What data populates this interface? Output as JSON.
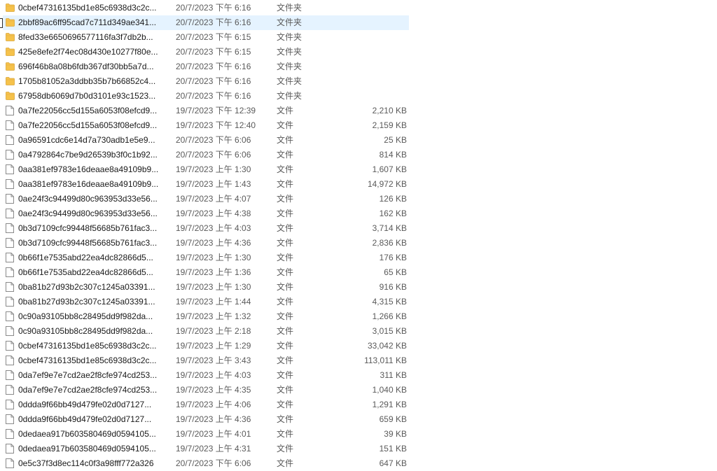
{
  "colors": {
    "folder": "#f6c24a",
    "hover_bg": "#e5f3ff"
  },
  "files": [
    {
      "name": "0cbef47316135bd1e85c6938d3c2c...",
      "date": "20/7/2023 下午 6:16",
      "type": "文件夹",
      "size": "",
      "icon": "folder-icon",
      "hovered": false
    },
    {
      "name": "2bbf89ac6ff95cad7c711d349ae341...",
      "date": "20/7/2023 下午 6:16",
      "type": "文件夹",
      "size": "",
      "icon": "folder-icon",
      "hovered": true
    },
    {
      "name": "8fed33e6650696577116fa3f7db2b...",
      "date": "20/7/2023 下午 6:15",
      "type": "文件夹",
      "size": "",
      "icon": "folder-icon",
      "hovered": false
    },
    {
      "name": "425e8efe2f74ec08d430e10277f80e...",
      "date": "20/7/2023 下午 6:15",
      "type": "文件夹",
      "size": "",
      "icon": "folder-icon",
      "hovered": false
    },
    {
      "name": "696f46b8a08b6fdb367df30bb5a7d...",
      "date": "20/7/2023 下午 6:16",
      "type": "文件夹",
      "size": "",
      "icon": "folder-icon",
      "hovered": false
    },
    {
      "name": "1705b81052a3ddbb35b7b66852c4...",
      "date": "20/7/2023 下午 6:16",
      "type": "文件夹",
      "size": "",
      "icon": "folder-icon",
      "hovered": false
    },
    {
      "name": "67958db6069d7b0d3101e93c1523...",
      "date": "20/7/2023 下午 6:16",
      "type": "文件夹",
      "size": "",
      "icon": "folder-icon",
      "hovered": false
    },
    {
      "name": "0a7fe22056cc5d155a6053f08efcd9...",
      "date": "19/7/2023 下午 12:39",
      "type": "文件",
      "size": "2,210 KB",
      "icon": "file-icon",
      "hovered": false
    },
    {
      "name": "0a7fe22056cc5d155a6053f08efcd9...",
      "date": "19/7/2023 下午 12:40",
      "type": "文件",
      "size": "2,159 KB",
      "icon": "file-icon",
      "hovered": false
    },
    {
      "name": "0a96591cdc6e14d7a730adb1e5e9...",
      "date": "20/7/2023 下午 6:06",
      "type": "文件",
      "size": "25 KB",
      "icon": "file-icon",
      "hovered": false
    },
    {
      "name": "0a4792864c7be9d26539b3f0c1b92...",
      "date": "20/7/2023 下午 6:06",
      "type": "文件",
      "size": "814 KB",
      "icon": "file-icon",
      "hovered": false
    },
    {
      "name": "0aa381ef9783e16deaae8a49109b9...",
      "date": "19/7/2023 上午 1:30",
      "type": "文件",
      "size": "1,607 KB",
      "icon": "file-icon",
      "hovered": false
    },
    {
      "name": "0aa381ef9783e16deaae8a49109b9...",
      "date": "19/7/2023 上午 1:43",
      "type": "文件",
      "size": "14,972 KB",
      "icon": "file-icon",
      "hovered": false
    },
    {
      "name": "0ae24f3c94499d80c963953d33e56...",
      "date": "19/7/2023 上午 4:07",
      "type": "文件",
      "size": "126 KB",
      "icon": "file-icon",
      "hovered": false
    },
    {
      "name": "0ae24f3c94499d80c963953d33e56...",
      "date": "19/7/2023 上午 4:38",
      "type": "文件",
      "size": "162 KB",
      "icon": "file-icon",
      "hovered": false
    },
    {
      "name": "0b3d7109cfc99448f56685b761fac3...",
      "date": "19/7/2023 上午 4:03",
      "type": "文件",
      "size": "3,714 KB",
      "icon": "file-icon",
      "hovered": false
    },
    {
      "name": "0b3d7109cfc99448f56685b761fac3...",
      "date": "19/7/2023 上午 4:36",
      "type": "文件",
      "size": "2,836 KB",
      "icon": "file-icon",
      "hovered": false
    },
    {
      "name": "0b66f1e7535abd22ea4dc82866d5...",
      "date": "19/7/2023 上午 1:30",
      "type": "文件",
      "size": "176 KB",
      "icon": "file-icon",
      "hovered": false
    },
    {
      "name": "0b66f1e7535abd22ea4dc82866d5...",
      "date": "19/7/2023 上午 1:36",
      "type": "文件",
      "size": "65 KB",
      "icon": "file-icon",
      "hovered": false
    },
    {
      "name": "0ba81b27d93b2c307c1245a03391...",
      "date": "19/7/2023 上午 1:30",
      "type": "文件",
      "size": "916 KB",
      "icon": "file-icon",
      "hovered": false
    },
    {
      "name": "0ba81b27d93b2c307c1245a03391...",
      "date": "19/7/2023 上午 1:44",
      "type": "文件",
      "size": "4,315 KB",
      "icon": "file-icon",
      "hovered": false
    },
    {
      "name": "0c90a93105bb8c28495dd9f982da...",
      "date": "19/7/2023 上午 1:32",
      "type": "文件",
      "size": "1,266 KB",
      "icon": "file-icon",
      "hovered": false
    },
    {
      "name": "0c90a93105bb8c28495dd9f982da...",
      "date": "19/7/2023 上午 2:18",
      "type": "文件",
      "size": "3,015 KB",
      "icon": "file-icon",
      "hovered": false
    },
    {
      "name": "0cbef47316135bd1e85c6938d3c2c...",
      "date": "19/7/2023 上午 1:29",
      "type": "文件",
      "size": "33,042 KB",
      "icon": "file-icon",
      "hovered": false
    },
    {
      "name": "0cbef47316135bd1e85c6938d3c2c...",
      "date": "19/7/2023 上午 3:43",
      "type": "文件",
      "size": "113,011 KB",
      "icon": "file-icon",
      "hovered": false
    },
    {
      "name": "0da7ef9e7e7cd2ae2f8cfe974cd253...",
      "date": "19/7/2023 上午 4:03",
      "type": "文件",
      "size": "311 KB",
      "icon": "file-icon",
      "hovered": false
    },
    {
      "name": "0da7ef9e7e7cd2ae2f8cfe974cd253...",
      "date": "19/7/2023 上午 4:35",
      "type": "文件",
      "size": "1,040 KB",
      "icon": "file-icon",
      "hovered": false
    },
    {
      "name": "0ddda9f66bb49d479fe02d0d7127...",
      "date": "19/7/2023 上午 4:06",
      "type": "文件",
      "size": "1,291 KB",
      "icon": "file-icon",
      "hovered": false
    },
    {
      "name": "0ddda9f66bb49d479fe02d0d7127...",
      "date": "19/7/2023 上午 4:36",
      "type": "文件",
      "size": "659 KB",
      "icon": "file-icon",
      "hovered": false
    },
    {
      "name": "0dedaea917b603580469d0594105...",
      "date": "19/7/2023 上午 4:01",
      "type": "文件",
      "size": "39 KB",
      "icon": "file-icon",
      "hovered": false
    },
    {
      "name": "0dedaea917b603580469d0594105...",
      "date": "19/7/2023 上午 4:31",
      "type": "文件",
      "size": "151 KB",
      "icon": "file-icon",
      "hovered": false
    },
    {
      "name": "0e5c37f3d8ec114c0f3a98fff772a326",
      "date": "20/7/2023 下午 6:06",
      "type": "文件",
      "size": "647 KB",
      "icon": "file-icon",
      "hovered": false
    }
  ]
}
